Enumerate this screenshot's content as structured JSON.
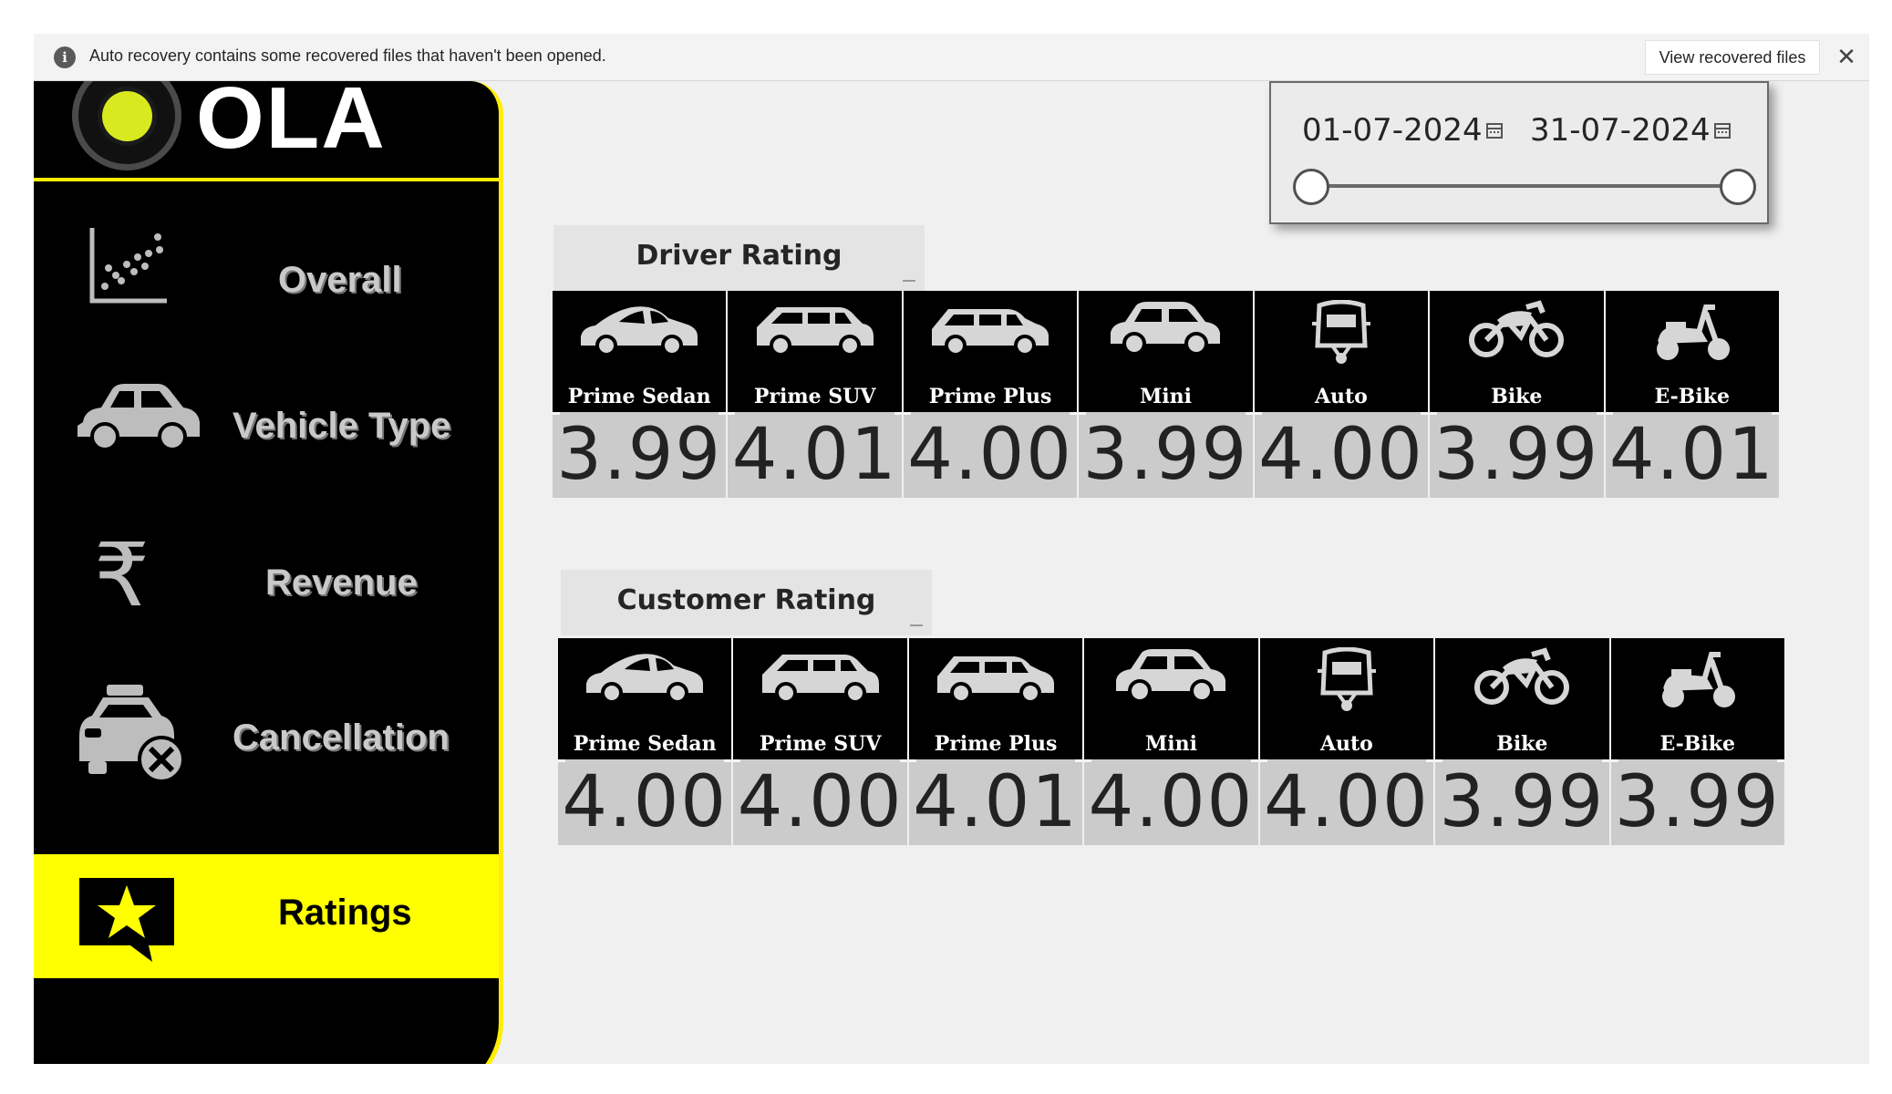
{
  "notification": {
    "message": "Auto recovery contains some recovered files that haven't been opened.",
    "view_button": "View recovered files",
    "info_glyph": "i",
    "close_glyph": "✕"
  },
  "brand": {
    "logo_text": "OLA",
    "accent": "#ffff00"
  },
  "nav": {
    "overall": "Overall",
    "vehicle_type": "Vehicle Type",
    "revenue": "Revenue",
    "revenue_glyph": "₹",
    "cancellation": "Cancellation",
    "ratings": "Ratings"
  },
  "date_filter": {
    "start": "01-07-2024",
    "end": "31-07-2024"
  },
  "driver_rating": {
    "title": "Driver Rating",
    "items": [
      {
        "vehicle": "Prime Sedan",
        "icon": "sedan-icon",
        "value": "3.99"
      },
      {
        "vehicle": "Prime SUV",
        "icon": "suv-icon",
        "value": "4.01"
      },
      {
        "vehicle": "Prime Plus",
        "icon": "hatchback-icon",
        "value": "4.00"
      },
      {
        "vehicle": "Mini",
        "icon": "mini-car-icon",
        "value": "3.99"
      },
      {
        "vehicle": "Auto",
        "icon": "auto-rickshaw-icon",
        "value": "4.00"
      },
      {
        "vehicle": "Bike",
        "icon": "motorbike-icon",
        "value": "3.99"
      },
      {
        "vehicle": "E-Bike",
        "icon": "scooter-icon",
        "value": "4.01"
      }
    ]
  },
  "customer_rating": {
    "title": "Customer Rating",
    "items": [
      {
        "vehicle": "Prime Sedan",
        "icon": "sedan-icon",
        "value": "4.00"
      },
      {
        "vehicle": "Prime SUV",
        "icon": "suv-icon",
        "value": "4.00"
      },
      {
        "vehicle": "Prime Plus",
        "icon": "hatchback-icon",
        "value": "4.01"
      },
      {
        "vehicle": "Mini",
        "icon": "mini-car-icon",
        "value": "4.00"
      },
      {
        "vehicle": "Auto",
        "icon": "auto-rickshaw-icon",
        "value": "4.00"
      },
      {
        "vehicle": "Bike",
        "icon": "motorbike-icon",
        "value": "3.99"
      },
      {
        "vehicle": "E-Bike",
        "icon": "scooter-icon",
        "value": "3.99"
      }
    ]
  }
}
